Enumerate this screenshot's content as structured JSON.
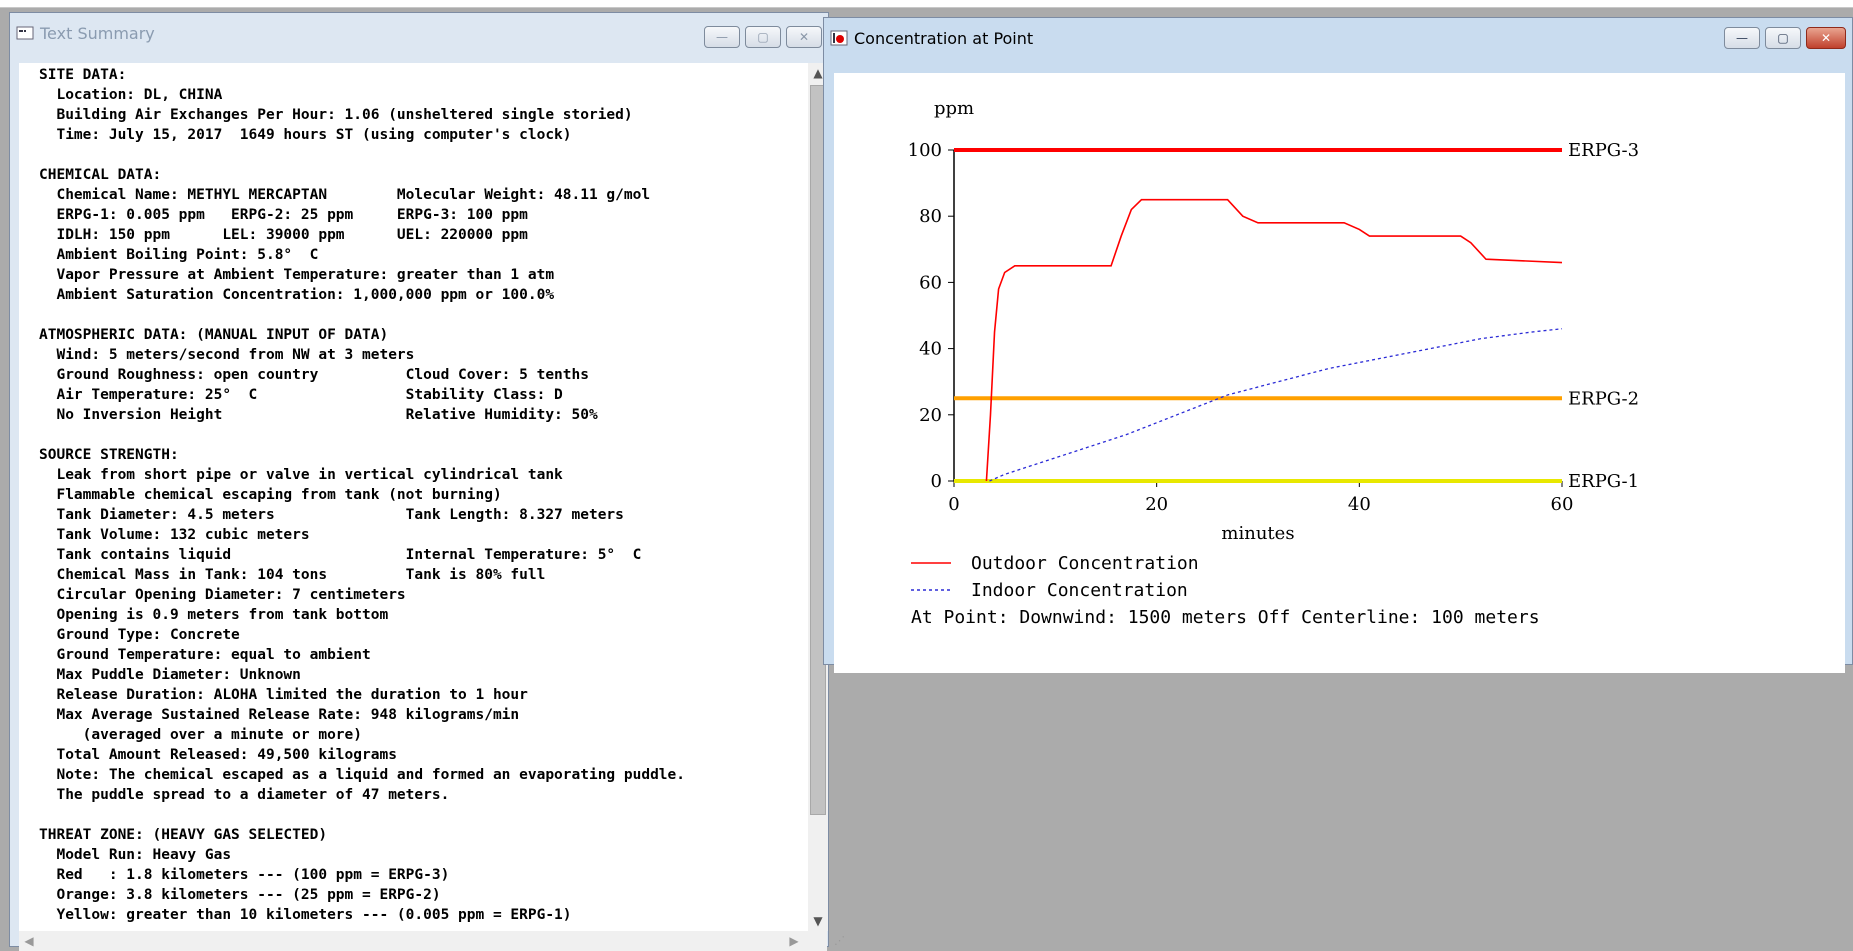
{
  "text_summary": {
    "title": "Text Summary",
    "controls": {
      "minimize": "—",
      "maximize": "▢",
      "close": "✕"
    },
    "lines": [
      "SITE DATA:",
      "  Location: DL, CHINA",
      "  Building Air Exchanges Per Hour: 1.06 (unsheltered single storied)",
      "  Time: July 15, 2017  1649 hours ST (using computer's clock)",
      "",
      "CHEMICAL DATA:",
      "  Chemical Name: METHYL MERCAPTAN        Molecular Weight: 48.11 g/mol",
      "  ERPG-1: 0.005 ppm   ERPG-2: 25 ppm     ERPG-3: 100 ppm",
      "  IDLH: 150 ppm      LEL: 39000 ppm      UEL: 220000 ppm",
      "  Ambient Boiling Point: 5.8°  C",
      "  Vapor Pressure at Ambient Temperature: greater than 1 atm",
      "  Ambient Saturation Concentration: 1,000,000 ppm or 100.0%",
      "",
      "ATMOSPHERIC DATA: (MANUAL INPUT OF DATA)",
      "  Wind: 5 meters/second from NW at 3 meters",
      "  Ground Roughness: open country          Cloud Cover: 5 tenths",
      "  Air Temperature: 25°  C                 Stability Class: D",
      "  No Inversion Height                     Relative Humidity: 50%",
      "",
      "SOURCE STRENGTH:",
      "  Leak from short pipe or valve in vertical cylindrical tank",
      "  Flammable chemical escaping from tank (not burning)",
      "  Tank Diameter: 4.5 meters               Tank Length: 8.327 meters",
      "  Tank Volume: 132 cubic meters",
      "  Tank contains liquid                    Internal Temperature: 5°  C",
      "  Chemical Mass in Tank: 104 tons         Tank is 80% full",
      "  Circular Opening Diameter: 7 centimeters",
      "  Opening is 0.9 meters from tank bottom",
      "  Ground Type: Concrete",
      "  Ground Temperature: equal to ambient",
      "  Max Puddle Diameter: Unknown",
      "  Release Duration: ALOHA limited the duration to 1 hour",
      "  Max Average Sustained Release Rate: 948 kilograms/min",
      "     (averaged over a minute or more)",
      "  Total Amount Released: 49,500 kilograms",
      "  Note: The chemical escaped as a liquid and formed an evaporating puddle.",
      "  The puddle spread to a diameter of 47 meters.",
      "",
      "THREAT ZONE: (HEAVY GAS SELECTED)",
      "  Model Run: Heavy Gas",
      "  Red   : 1.8 kilometers --- (100 ppm = ERPG-3)",
      "  Orange: 3.8 kilometers --- (25 ppm = ERPG-2)",
      "  Yellow: greater than 10 kilometers --- (0.005 ppm = ERPG-1)"
    ]
  },
  "concentration_window": {
    "title": "Concentration at Point",
    "controls": {
      "minimize": "—",
      "maximize": "▢",
      "close": "✕"
    },
    "legend": [
      {
        "label": "Outdoor Concentration"
      },
      {
        "label": "Indoor Concentration"
      }
    ],
    "at_point": "At Point:   Downwind: 1500 meters   Off Centerline: 100 meters"
  },
  "colors": {
    "outdoor": "#ff0000",
    "indoor": "#2b2bd6",
    "erpg3": "#ff0000",
    "erpg2": "#ffa000",
    "erpg1": "#e8e800",
    "desktop": "#ababab"
  },
  "chart_data": {
    "type": "line",
    "xlabel": "minutes",
    "ylabel": "ppm",
    "xlim": [
      0,
      60
    ],
    "ylim": [
      0,
      100
    ],
    "xticks": [
      0,
      20,
      40,
      60
    ],
    "yticks": [
      0,
      20,
      40,
      60,
      80,
      100
    ],
    "thresholds": [
      {
        "name": "ERPG-3",
        "value": 100
      },
      {
        "name": "ERPG-2",
        "value": 25
      },
      {
        "name": "ERPG-1",
        "value": 0
      }
    ],
    "series": [
      {
        "name": "Outdoor Concentration",
        "style": "solid",
        "x": [
          3.2,
          3.6,
          4.0,
          4.4,
          5.0,
          6.0,
          10,
          15.5,
          16.5,
          17.5,
          18.5,
          25,
          27,
          28.5,
          30,
          38.5,
          40,
          41,
          50,
          51,
          52.5,
          60
        ],
        "y": [
          0,
          20,
          45,
          58,
          63,
          65,
          65,
          65,
          74,
          82,
          85,
          85,
          85,
          80,
          78,
          78,
          76,
          74,
          74,
          72,
          67,
          66
        ]
      },
      {
        "name": "Indoor Concentration",
        "style": "dotted",
        "x": [
          3.5,
          5,
          8,
          12,
          17,
          22,
          27,
          32,
          37,
          42,
          47,
          52,
          57,
          60
        ],
        "y": [
          0,
          2,
          5,
          9,
          14,
          20,
          26,
          30,
          34,
          37,
          40,
          43,
          45,
          46
        ]
      }
    ]
  }
}
